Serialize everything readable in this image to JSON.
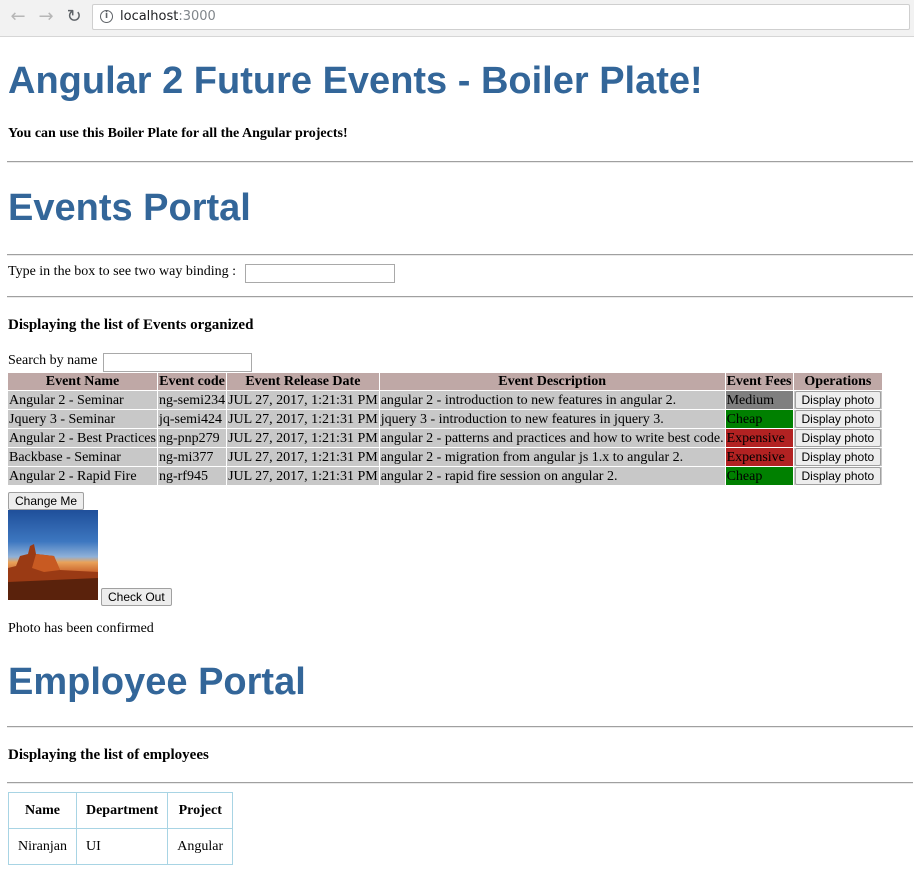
{
  "browser": {
    "back_icon": "arrow-left-icon",
    "forward_icon": "arrow-right-icon",
    "reload_icon": "reload-icon",
    "info_icon": "info-icon",
    "url_host": "localhost",
    "url_port": ":3000"
  },
  "header": {
    "title": "Angular 2 Future Events - Boiler Plate!",
    "subtitle": "You can use this Boiler Plate for all the Angular projects!"
  },
  "events_portal": {
    "heading": "Events Portal",
    "binding_label": "Type in the box to see two way binding :",
    "binding_value": "",
    "list_heading": "Displaying the list of Events organized",
    "search_label": "Search by name",
    "search_value": "",
    "columns": [
      "Event Name",
      "Event code",
      "Event Release Date",
      "Event Description",
      "Event Fees",
      "Operations"
    ],
    "rows": [
      {
        "name": "Angular 2 - Seminar",
        "code": "ng-semi234",
        "date": "JUL 27, 2017, 1:21:31 PM",
        "description": "angular 2 - introduction to new features in angular 2.",
        "fees": "Medium",
        "fee_color": "#7f7f7f",
        "action": "Display photo"
      },
      {
        "name": "Jquery 3 - Seminar",
        "code": "jq-semi424",
        "date": "JUL 27, 2017, 1:21:31 PM",
        "description": "jquery 3 - introduction to new features in jquery 3.",
        "fees": "Cheap",
        "fee_color": "#008000",
        "action": "Display photo"
      },
      {
        "name": "Angular 2 - Best Practices",
        "code": "ng-pnp279",
        "date": "JUL 27, 2017, 1:21:31 PM",
        "description": "angular 2 - patterns and practices and how to write best code.",
        "fees": "Expensive",
        "fee_color": "#b22222",
        "action": "Display photo"
      },
      {
        "name": "Backbase - Seminar",
        "code": "ng-mi377",
        "date": "JUL 27, 2017, 1:21:31 PM",
        "description": "angular 2 - migration from angular js 1.x to angular 2.",
        "fees": "Expensive",
        "fee_color": "#b22222",
        "action": "Display photo"
      },
      {
        "name": "Angular 2 - Rapid Fire",
        "code": "ng-rf945",
        "date": "JUL 27, 2017, 1:21:31 PM",
        "description": "angular 2 - rapid fire session on angular 2.",
        "fees": "Cheap",
        "fee_color": "#008000",
        "action": "Display photo"
      }
    ],
    "change_button": "Change Me",
    "checkout_button": "Check Out",
    "confirmation": "Photo has been confirmed"
  },
  "employee_portal": {
    "heading": "Employee Portal",
    "list_heading": "Displaying the list of employees",
    "columns": [
      "Name",
      "Department",
      "Project"
    ],
    "rows": [
      {
        "name": "Niranjan",
        "department": "UI",
        "project": "Angular"
      }
    ]
  }
}
